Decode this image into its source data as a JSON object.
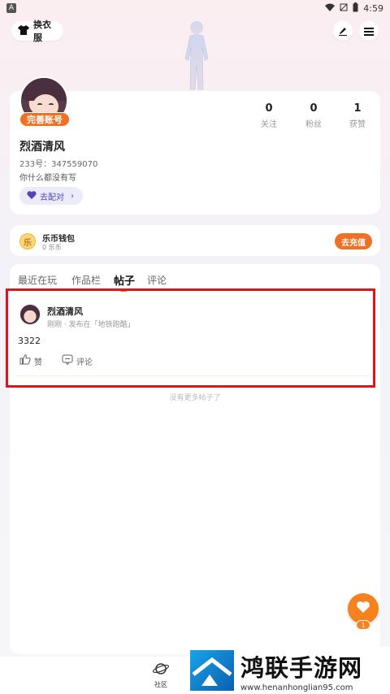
{
  "status_bar": {
    "badge": "A",
    "time": "4:59"
  },
  "header": {
    "dress_label": "换衣服"
  },
  "profile": {
    "complete_badge": "完善账号",
    "username": "烈酒清风",
    "uid": "233号：347559070",
    "bio": "你什么都没有写",
    "match_label": "去配对",
    "stats": [
      {
        "num": "0",
        "label": "关注"
      },
      {
        "num": "0",
        "label": "粉丝"
      },
      {
        "num": "1",
        "label": "获赞"
      }
    ]
  },
  "wallet": {
    "icon_text": "乐",
    "title": "乐币钱包",
    "sub": "0 乐币",
    "recharge_label": "去充值"
  },
  "tabs": [
    {
      "label": "最近在玩",
      "active": false
    },
    {
      "label": "作品栏",
      "active": false
    },
    {
      "label": "帖子",
      "active": true
    },
    {
      "label": "评论",
      "active": false
    }
  ],
  "post": {
    "author": "烈酒清风",
    "meta": "刚刚 · 发布在「地铁跑酷」",
    "body": "3322",
    "like_label": "赞",
    "comment_label": "评论"
  },
  "no_more": "没有更多帖子了",
  "like_fab": {
    "count": "1"
  },
  "bottom_nav": {
    "community_label": "社区"
  },
  "watermark": {
    "title": "鸿联手游网",
    "url": "www.henanhonglian95.com"
  },
  "colors": {
    "accent": "#f07024",
    "highlight": "#e0141c",
    "match_text": "#5046b8"
  }
}
